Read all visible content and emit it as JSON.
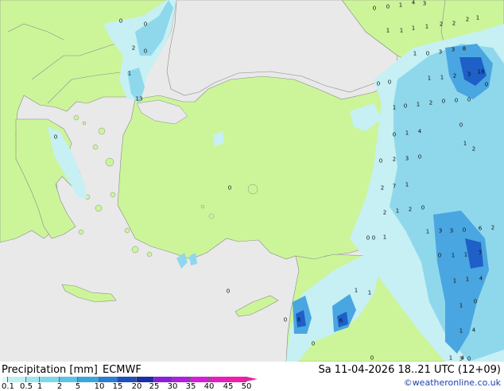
{
  "header": {
    "product": "Precipitation [mm]",
    "model": "ECMWF",
    "valid_time": "Sa 11-04-2026 18..21 UTC (12+09)",
    "credit": "©weatheronline.co.uk"
  },
  "legend": {
    "ticks": [
      "0.1",
      "0.5",
      "1",
      "2",
      "5",
      "10",
      "15",
      "20",
      "25",
      "30",
      "35",
      "40",
      "45",
      "50"
    ],
    "colors": [
      "#dff7f7",
      "#bdf0f0",
      "#9ee6ee",
      "#7ed8ec",
      "#5ec3e6",
      "#3aa6de",
      "#2a7fd0",
      "#1e4fbe",
      "#1a2ea8",
      "#8a1ee0",
      "#b01ee0",
      "#d51ed8",
      "#e51ec4",
      "#f01ea8"
    ]
  },
  "colors": {
    "sea": "#e9e9e9",
    "land": "#ccf59a",
    "border": "#8a8a8a",
    "rain_light": "#c6f0f4",
    "rain_mid": "#8fd8ec",
    "rain_heavy": "#4aa6e0",
    "rain_core": "#1e5fc8"
  },
  "values": [
    {
      "v": "0"
    },
    {
      "v": "0"
    },
    {
      "v": "1"
    },
    {
      "v": "4"
    },
    {
      "v": "3"
    },
    {
      "v": "0"
    },
    {
      "v": "0"
    },
    {
      "v": "2"
    },
    {
      "v": "0"
    },
    {
      "v": "1"
    },
    {
      "v": "1"
    },
    {
      "v": "1"
    },
    {
      "v": "1"
    },
    {
      "v": "2"
    },
    {
      "v": "2"
    },
    {
      "v": "2"
    },
    {
      "v": "1"
    },
    {
      "v": "1"
    },
    {
      "v": "0"
    },
    {
      "v": "3"
    },
    {
      "v": "3"
    },
    {
      "v": "8"
    },
    {
      "v": "1"
    },
    {
      "v": "1"
    },
    {
      "v": "1"
    },
    {
      "v": "2"
    },
    {
      "v": "3"
    },
    {
      "v": "18"
    },
    {
      "v": "13"
    },
    {
      "v": "0"
    },
    {
      "v": "0"
    },
    {
      "v": "0"
    },
    {
      "v": "1"
    },
    {
      "v": "0"
    },
    {
      "v": "1"
    },
    {
      "v": "2"
    },
    {
      "v": "0"
    },
    {
      "v": "0"
    },
    {
      "v": "0"
    },
    {
      "v": "0"
    },
    {
      "v": "1"
    },
    {
      "v": "4"
    },
    {
      "v": "0"
    },
    {
      "v": "1"
    },
    {
      "v": "2"
    },
    {
      "v": "0"
    },
    {
      "v": "2"
    },
    {
      "v": "3"
    },
    {
      "v": "0"
    },
    {
      "v": "0"
    },
    {
      "v": "2"
    },
    {
      "v": "7"
    },
    {
      "v": "1"
    },
    {
      "v": "0"
    },
    {
      "v": "2"
    },
    {
      "v": "1"
    },
    {
      "v": "2"
    },
    {
      "v": "0"
    },
    {
      "v": "0"
    },
    {
      "v": "0"
    },
    {
      "v": "1"
    },
    {
      "v": "1"
    },
    {
      "v": "3"
    },
    {
      "v": "3"
    },
    {
      "v": "0"
    },
    {
      "v": "6"
    },
    {
      "v": "2"
    },
    {
      "v": "0"
    },
    {
      "v": "1"
    },
    {
      "v": "1"
    },
    {
      "v": "7"
    },
    {
      "v": "1"
    },
    {
      "v": "1"
    },
    {
      "v": "4"
    },
    {
      "v": "1"
    },
    {
      "v": "0"
    },
    {
      "v": "1"
    },
    {
      "v": "0"
    },
    {
      "v": "1"
    },
    {
      "v": "0"
    },
    {
      "v": "8"
    },
    {
      "v": "0"
    },
    {
      "v": "6"
    },
    {
      "v": "1"
    },
    {
      "v": "4"
    },
    {
      "v": "0"
    },
    {
      "v": "1"
    },
    {
      "v": "4"
    },
    {
      "v": "3"
    },
    {
      "v": "0"
    }
  ]
}
